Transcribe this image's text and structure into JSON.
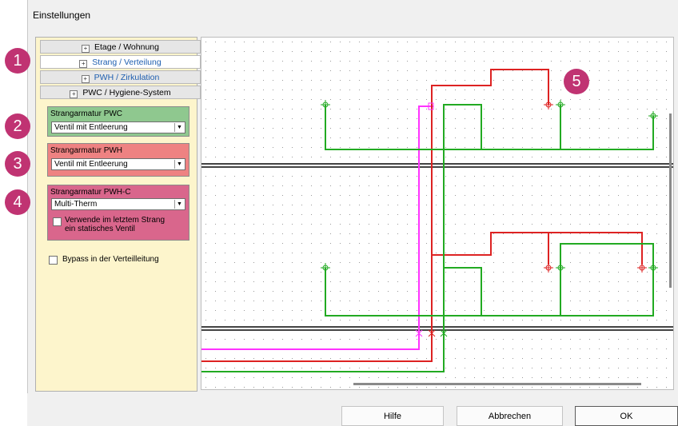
{
  "window": {
    "title": "Einstellungen"
  },
  "categories": [
    {
      "label": "Etage / Wohnung",
      "state": "normal"
    },
    {
      "label": "Strang / Verteilung",
      "state": "selected"
    },
    {
      "label": "PWH / Zirkulation",
      "state": "blue"
    },
    {
      "label": "PWC / Hygiene-System",
      "state": "normal"
    }
  ],
  "groups": {
    "pwc": {
      "label": "Strangarmatur PWC",
      "value": "Ventil mit Entleerung",
      "color": "#8fc88f"
    },
    "pwh": {
      "label": "Strangarmatur PWH",
      "value": "Ventil mit Entleerung",
      "color": "#ee8282"
    },
    "pwhc": {
      "label": "Strangarmatur PWH-C",
      "value": "Multi-Therm",
      "color": "#d9668c",
      "checkbox_label_1": "Verwende im letztem Strang",
      "checkbox_label_2": "ein statisches Ventil",
      "checkbox_checked": false
    }
  },
  "bypass": {
    "label": "Bypass in der Verteilleitung",
    "checked": false
  },
  "badges": [
    "1",
    "2",
    "3",
    "4",
    "5"
  ],
  "buttons": {
    "help": "Hilfe",
    "cancel": "Abbrechen",
    "ok": "OK"
  },
  "colors": {
    "pwc_line": "#22aa22",
    "pwh_line": "#dd2222",
    "circ_line": "#ff33ff",
    "badge": "#c03372",
    "panel_bg": "#fdf5cc"
  }
}
